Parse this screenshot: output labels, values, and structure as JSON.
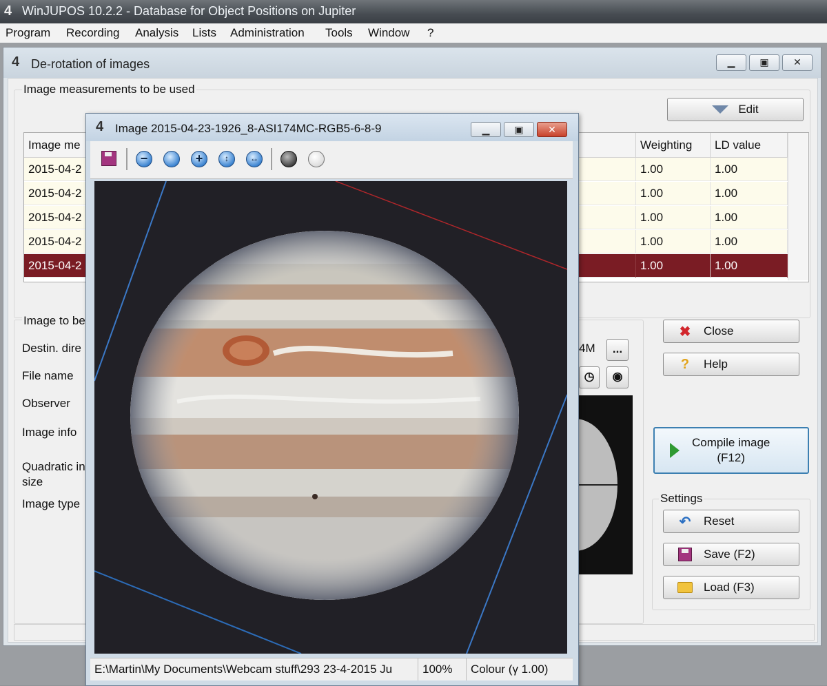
{
  "app": {
    "title": "WinJUPOS 10.2.2 - Database for Object Positions on Jupiter",
    "menu": [
      "Program",
      "Recording",
      "Analysis",
      "Lists",
      "Administration",
      "Tools",
      "Window",
      "?"
    ]
  },
  "derotation": {
    "title": "De-rotation of images",
    "group_measurements": "Image measurements to be used",
    "edit_label": "Edit",
    "table": {
      "headers": [
        "Image me",
        "Weighting",
        "LD value"
      ],
      "rows": [
        {
          "image": "2015-04-2",
          "weighting": "1.00",
          "ld": "1.00"
        },
        {
          "image": "2015-04-2",
          "weighting": "1.00",
          "ld": "1.00"
        },
        {
          "image": "2015-04-2",
          "weighting": "1.00",
          "ld": "1.00"
        },
        {
          "image": "2015-04-2",
          "weighting": "1.00",
          "ld": "1.00"
        },
        {
          "image": "2015-04-2",
          "weighting": "1.00",
          "ld": "1.00",
          "selected": true
        }
      ]
    },
    "group_image": "Image to be",
    "labels": {
      "destin": "Destin. dire",
      "file_name": "File name",
      "observer": "Observer",
      "image_info": "Image info",
      "quadratic_1": "Quadratic in",
      "quadratic_2": "size",
      "image_type": "Image type"
    },
    "destin_value_fragment": "4M",
    "browse_label": "...",
    "buttons": {
      "close": "Close",
      "help": "Help",
      "compile_line1": "Compile image",
      "compile_line2": "(F12)",
      "settings_group": "Settings",
      "reset": "Reset",
      "save": "Save (F2)",
      "load": "Load (F3)"
    }
  },
  "image_window": {
    "title": "Image  2015-04-23-1926_8-ASI174MC-RGB5-6-8-9",
    "status": {
      "path": "E:\\Martin\\My Documents\\Webcam stuff\\293 23-4-2015 Ju",
      "zoom": "100%",
      "colour": "Colour (γ 1.00)"
    }
  },
  "colors": {
    "selection": "#7a1c24",
    "row_bg": "#fdfbeb",
    "compile_border": "#3c7fb1"
  }
}
